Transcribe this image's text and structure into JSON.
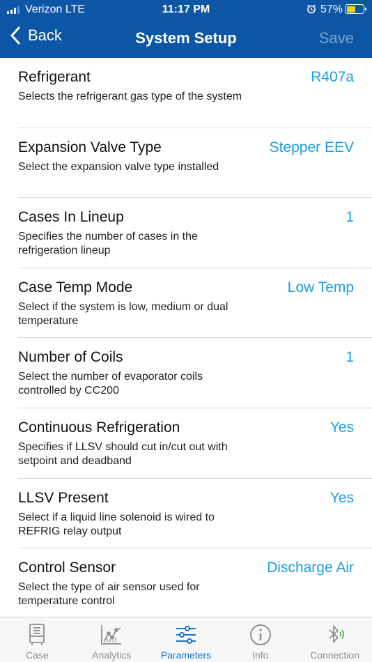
{
  "status_bar": {
    "carrier": "Verizon  LTE",
    "time": "11:17 PM",
    "battery_percent": "57%",
    "battery_level": 0.57
  },
  "nav": {
    "back_label": "Back",
    "title": "System Setup",
    "save_label": "Save"
  },
  "settings": [
    {
      "title": "Refrigerant",
      "value": "R407a",
      "description": "Selects the refrigerant gas type of the system"
    },
    {
      "title": "Expansion Valve Type",
      "value": "Stepper EEV",
      "description": "Select the expansion valve type installed"
    },
    {
      "title": "Cases In Lineup",
      "value": "1",
      "description": "Specifies the number of cases in the refrigeration lineup"
    },
    {
      "title": "Case Temp Mode",
      "value": "Low Temp",
      "description": "Select if the system is low, medium or dual temperature"
    },
    {
      "title": "Number of Coils",
      "value": "1",
      "description": "Select the number of evaporator coils controlled by CC200"
    },
    {
      "title": "Continuous Refrigeration",
      "value": "Yes",
      "description": "Specifies if LLSV should cut in/cut out with setpoint and deadband"
    },
    {
      "title": "LLSV Present",
      "value": "Yes",
      "description": "Select if a liquid line solenoid is wired to REFRIG relay output"
    },
    {
      "title": "Control Sensor",
      "value": "Discharge Air",
      "description": "Select the type of air sensor used for temperature control"
    }
  ],
  "tabs": [
    {
      "label": "Case",
      "icon": "case-icon",
      "active": false
    },
    {
      "label": "Analytics",
      "icon": "analytics-icon",
      "active": false
    },
    {
      "label": "Parameters",
      "icon": "parameters-icon",
      "active": true
    },
    {
      "label": "Info",
      "icon": "info-icon",
      "active": false
    },
    {
      "label": "Connection",
      "icon": "bluetooth-icon",
      "active": false
    }
  ],
  "colors": {
    "header": "#0d56a6",
    "value_text": "#1aa0e0",
    "active_tab": "#1173c8",
    "inactive_tab": "#8d8d8d",
    "battery": "#f7d21b"
  }
}
